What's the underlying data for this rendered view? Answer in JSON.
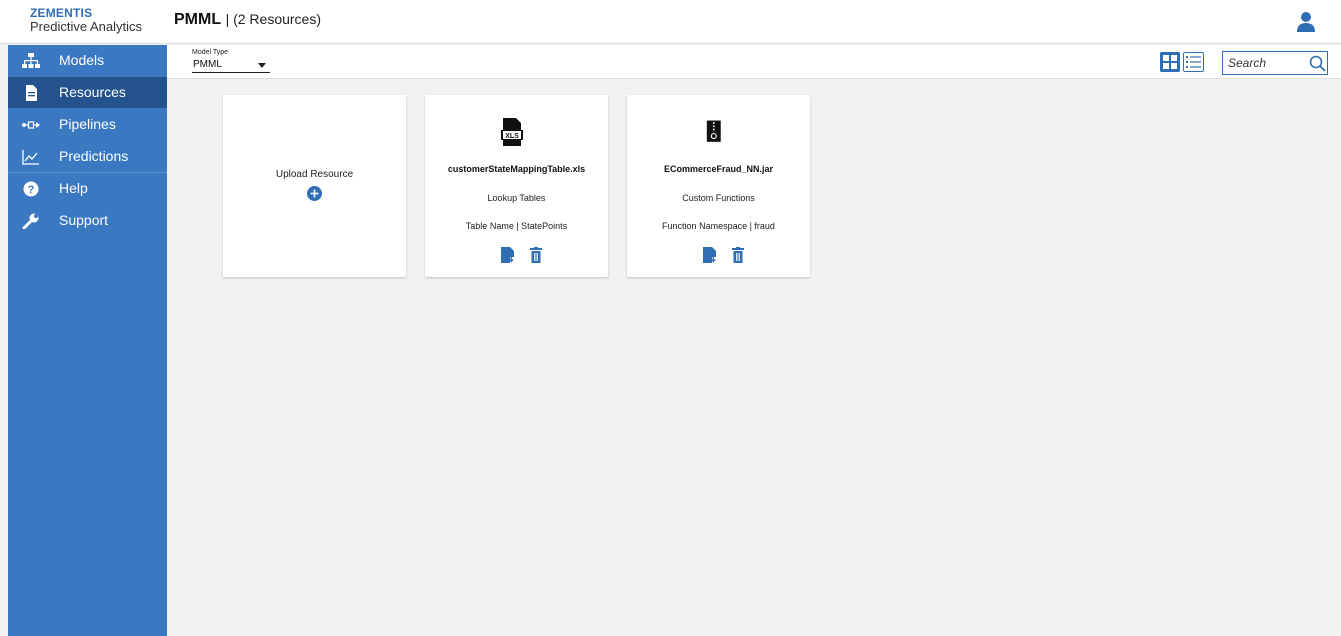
{
  "brand": {
    "name": "ZEMENTIS",
    "product": "Predictive Analytics"
  },
  "header": {
    "title": "PMML",
    "subtitle": "| (2 Resources)",
    "user_icon": "user-icon"
  },
  "sidebar": {
    "items": [
      {
        "label": "Models",
        "icon": "sitemap-icon",
        "active": false
      },
      {
        "label": "Resources",
        "icon": "document-icon",
        "active": true
      },
      {
        "label": "Pipelines",
        "icon": "pipeline-icon",
        "active": false
      },
      {
        "label": "Predictions",
        "icon": "line-chart-icon",
        "active": false
      },
      {
        "label": "Help",
        "icon": "help-icon",
        "active": false
      },
      {
        "label": "Support",
        "icon": "wrench-icon",
        "active": false
      }
    ]
  },
  "toolbar": {
    "model_type_label": "Model Type",
    "model_type_value": "PMML",
    "search_placeholder": "Search",
    "views": [
      "grid-view-icon",
      "list-view-icon"
    ]
  },
  "upload_card": {
    "label": "Upload Resource",
    "icon": "plus-circle-icon"
  },
  "resources": [
    {
      "name": "customerStateMappingTable.xls",
      "type": "Lookup Tables",
      "detail": "Table Name | StatePoints",
      "icon": "xls-file-icon"
    },
    {
      "name": "ECommerceFraud_NN.jar",
      "type": "Custom Functions",
      "detail": "Function Namespace | fraud",
      "icon": "zip-file-icon"
    }
  ],
  "colors": {
    "accent": "#2f6db5",
    "sidebar": "#3a78c2",
    "sidebar_active": "#23528d",
    "background": "#f2f2f2"
  }
}
